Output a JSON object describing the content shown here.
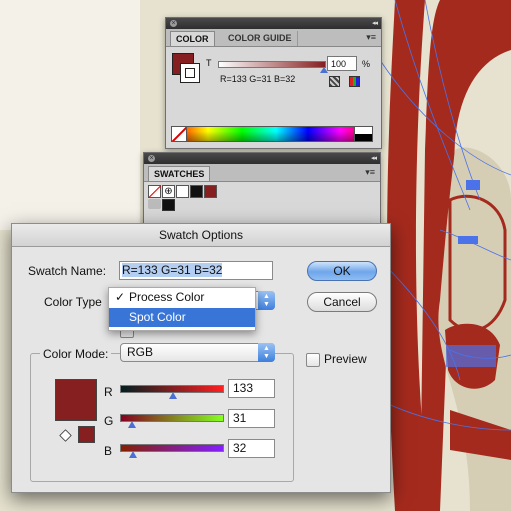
{
  "color_panel": {
    "tabs": [
      "COLOR",
      "COLOR GUIDE"
    ],
    "tint_label": "T",
    "tint_value": "100",
    "tint_unit": "%",
    "rgb_readout": "R=133 G=31 B=32",
    "fill_color": "#851f20"
  },
  "swatches_panel": {
    "tabs": [
      "SWATCHES"
    ],
    "swatches": [
      "none",
      "registration",
      "white",
      "black",
      "custom-red"
    ]
  },
  "dialog": {
    "title": "Swatch Options",
    "swatch_name_label": "Swatch Name:",
    "swatch_name_value": "R=133 G=31 B=32",
    "color_type_label": "Color Type",
    "color_type_options": [
      "Process Color",
      "Spot Color"
    ],
    "color_type_checked": "Process Color",
    "color_type_highlighted": "Spot Color",
    "color_mode_label": "Color Mode:",
    "color_mode_value": "RGB",
    "preview_label": "Preview",
    "preview_checked": false,
    "ok_label": "OK",
    "cancel_label": "Cancel",
    "channels": [
      {
        "label": "R",
        "value": "133",
        "level": 0.52
      },
      {
        "label": "G",
        "value": "31",
        "level": 0.12
      },
      {
        "label": "B",
        "value": "32",
        "level": 0.13
      }
    ],
    "swatch_color": "#851f20"
  },
  "colors": {
    "artwork_red": "#a42a1d",
    "artwork_cream": "#e6e2cf",
    "selection_blue": "#4b72e8"
  }
}
